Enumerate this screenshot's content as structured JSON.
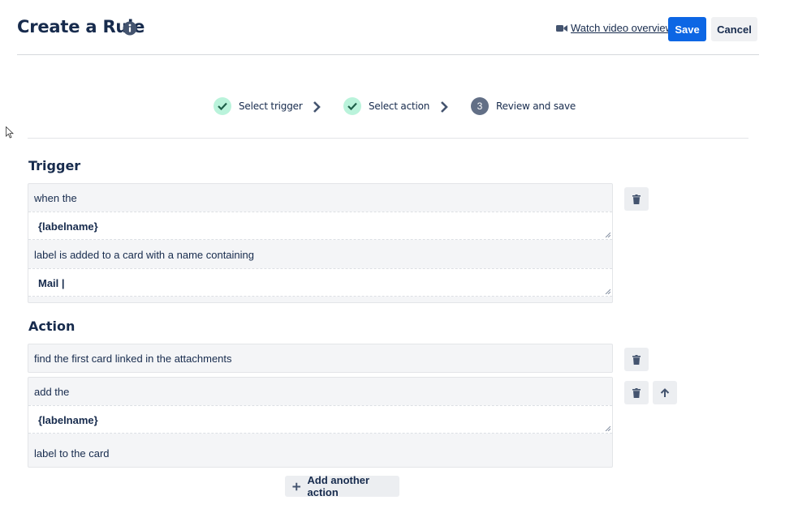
{
  "header": {
    "title": "Create a Rule",
    "watch_video": "Watch video overview",
    "save_label": "Save",
    "cancel_label": "Cancel"
  },
  "steps": [
    {
      "label": "Select trigger",
      "state": "done"
    },
    {
      "label": "Select action",
      "state": "done"
    },
    {
      "label": "Review and save",
      "number": "3",
      "state": "current"
    }
  ],
  "trigger": {
    "title": "Trigger",
    "line1": "when the",
    "field1": "{labelname}",
    "line2": "label is added to a card with a name containing",
    "field2": "Mail |"
  },
  "action": {
    "title": "Action",
    "action1": "find the first card linked in the attachments",
    "action2_line1": "add the",
    "action2_field": "{labelname}",
    "action2_line2": "label to the card",
    "add_another": "Add another action"
  },
  "colors": {
    "primary": "#0c66e4",
    "text": "#172b4d",
    "done_circle": "#baf3db",
    "done_check": "#1f845a",
    "current_circle": "#626f86"
  },
  "icons": [
    "info-icon",
    "video-camera-icon",
    "check-icon",
    "chevron-right-icon",
    "trash-icon",
    "arrow-up-icon",
    "plus-icon",
    "mouse-cursor-icon"
  ]
}
